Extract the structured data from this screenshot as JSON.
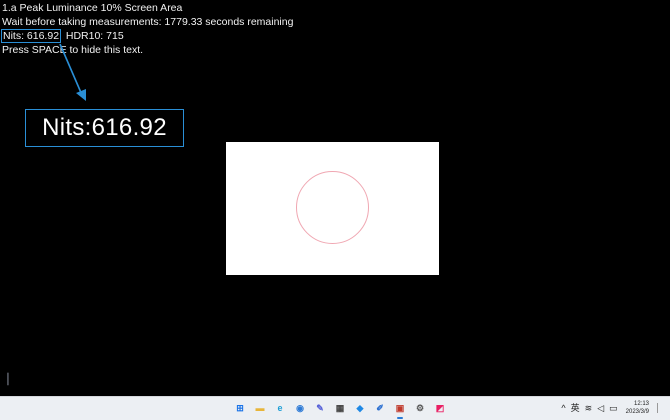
{
  "overlay": {
    "line1": "1.a Peak Luminance  10% Screen Area",
    "line2": "Wait before taking measurements: 1779.33 seconds remaining",
    "nits": "Nits: 616.92",
    "hdr10": "  HDR10: 715",
    "line4": "Press SPACE to hide this text."
  },
  "zoom_callout": {
    "text": "Nits:616.92"
  },
  "colors": {
    "accent_blue": "#2a8fd6",
    "background": "#000000",
    "patch": "#ffffff",
    "ring": "#f0a7b2",
    "taskbar": "#eceff3"
  },
  "taskbar": {
    "icons": [
      {
        "name": "start-windows-icon",
        "glyph": "⊞",
        "color": "#1a73e8"
      },
      {
        "name": "file-explorer-icon",
        "glyph": "▬",
        "color": "#e8b53a"
      },
      {
        "name": "edge-browser-icon",
        "glyph": "e",
        "color": "#1f9fd6"
      },
      {
        "name": "photos-app-icon",
        "glyph": "◉",
        "color": "#2d7ad6"
      },
      {
        "name": "pen-app-icon",
        "glyph": "✎",
        "color": "#5560d8"
      },
      {
        "name": "store-app-icon",
        "glyph": "▦",
        "color": "#444"
      },
      {
        "name": "blue-app-icon",
        "glyph": "◆",
        "color": "#1e88e5"
      },
      {
        "name": "tool-app-icon",
        "glyph": "✐",
        "color": "#2a6fd1"
      },
      {
        "name": "hdr-test-app-icon",
        "glyph": "▣",
        "color": "#c0392b"
      },
      {
        "name": "settings-gear-icon",
        "glyph": "⚙",
        "color": "#555"
      },
      {
        "name": "color-app-icon",
        "glyph": "◩",
        "color": "#e91e63"
      }
    ],
    "active_index": 8,
    "tray": {
      "chevron": "^",
      "lang": "英",
      "wifi": "≋",
      "volume": "◁",
      "battery": "▭",
      "time": "12:13",
      "date": "2023/3/9"
    }
  }
}
